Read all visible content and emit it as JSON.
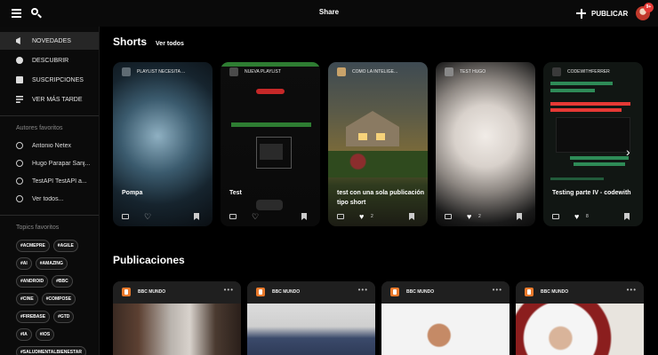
{
  "header": {
    "title": "Share",
    "publish_label": "PUBLICAR",
    "notification_count": "9+"
  },
  "sidebar": {
    "nav": [
      {
        "label": "NOVEDADES",
        "icon": "megaphone-icon",
        "active": true
      },
      {
        "label": "DESCUBRIR",
        "icon": "compass-icon"
      },
      {
        "label": "SUSCRIPCIONES",
        "icon": "subscriptions-icon"
      },
      {
        "label": "VER MÁS TARDE",
        "icon": "watch-later-icon"
      }
    ],
    "authors_title": "Autores favoritos",
    "authors": [
      "Antonio Netex",
      "Hugo Parapar Sanj...",
      "TestAPI TestAPI a...",
      "Ver todos..."
    ],
    "topics_title": "Topics favoritos",
    "topics": [
      "#ACMEPRE",
      "#AGILE",
      "#AI",
      "#AMAZING",
      "#ANDROID",
      "#BBC",
      "#CINE",
      "#COMPOSE",
      "#FIREBASE",
      "#GTD",
      "#IA",
      "#IOS",
      "#SALUDMENTALBIENESTAR"
    ]
  },
  "shorts": {
    "title": "Shorts",
    "see_all": "Ver todos",
    "cards": [
      {
        "channel": "PLAYLIST NECESITA ...",
        "title": "Pompa",
        "likes": "",
        "liked": false
      },
      {
        "channel": "NUEVA PLAYLIST",
        "title": "Test",
        "likes": "",
        "liked": false
      },
      {
        "channel": "COMO LA INTELIGE...",
        "title": "test con una sola publicación tipo short",
        "likes": "2",
        "liked": true
      },
      {
        "channel": "TEST HUGO",
        "title": "",
        "likes": "2",
        "liked": true
      },
      {
        "channel": "CODEWITHFERRER",
        "title": "Testing parte IV - codewith",
        "likes": "8",
        "liked": true
      }
    ]
  },
  "publications": {
    "title": "Publicaciones",
    "cards": [
      {
        "source": "BBC MUNDO"
      },
      {
        "source": "BBC MUNDO"
      },
      {
        "source": "BBC MUNDO"
      },
      {
        "source": "BBC MUNDO"
      }
    ]
  },
  "colors": {
    "accent": "#e53935",
    "background": "#000000",
    "card": "#1e1e1e",
    "brand_logo": "#e8792b"
  }
}
